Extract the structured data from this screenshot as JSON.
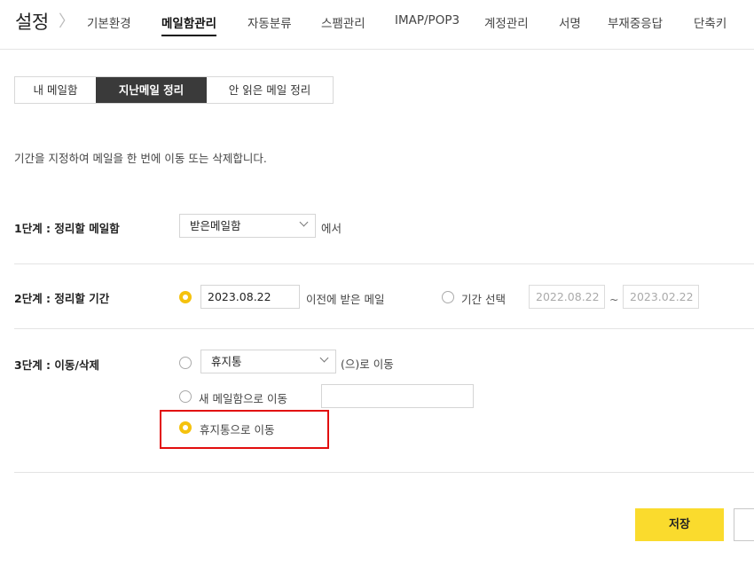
{
  "nav": {
    "title": "설정",
    "items": [
      "기본환경",
      "메일함관리",
      "자동분류",
      "스팸관리",
      "IMAP/POP3",
      "계정관리",
      "서명",
      "부재중응답",
      "단축키"
    ],
    "active_index": 1
  },
  "tabs": [
    "내 메일함",
    "지난메일 정리",
    "안 읽은 메일 정리"
  ],
  "description": "기간을 지정하여 메일을 한 번에 이동 또는 삭제합니다.",
  "step1": {
    "label": "1단계 : 정리할 메일함",
    "mailbox": "받은메일함",
    "suffix": "에서"
  },
  "step2": {
    "label": "2단계 : 정리할 기간",
    "date": "2023.08.22",
    "before_text": "이전에 받은 메일",
    "range_label": "기간 선택",
    "range_from": "2022.08.22",
    "range_sep": "~",
    "range_to": "2023.02.22"
  },
  "step3": {
    "label": "3단계 : 이동/삭제",
    "folder": "휴지통",
    "move_suffix": "(으)로 이동",
    "new_folder_label": "새 메일함으로 이동",
    "new_folder_value": "",
    "trash_label": "휴지통으로 이동"
  },
  "buttons": {
    "save": "저장"
  },
  "colors": {
    "accent": "#f5c20e",
    "save_bg": "#fadb2d",
    "highlight": "#e20e0e",
    "tab_selected": "#3a3a3a"
  }
}
